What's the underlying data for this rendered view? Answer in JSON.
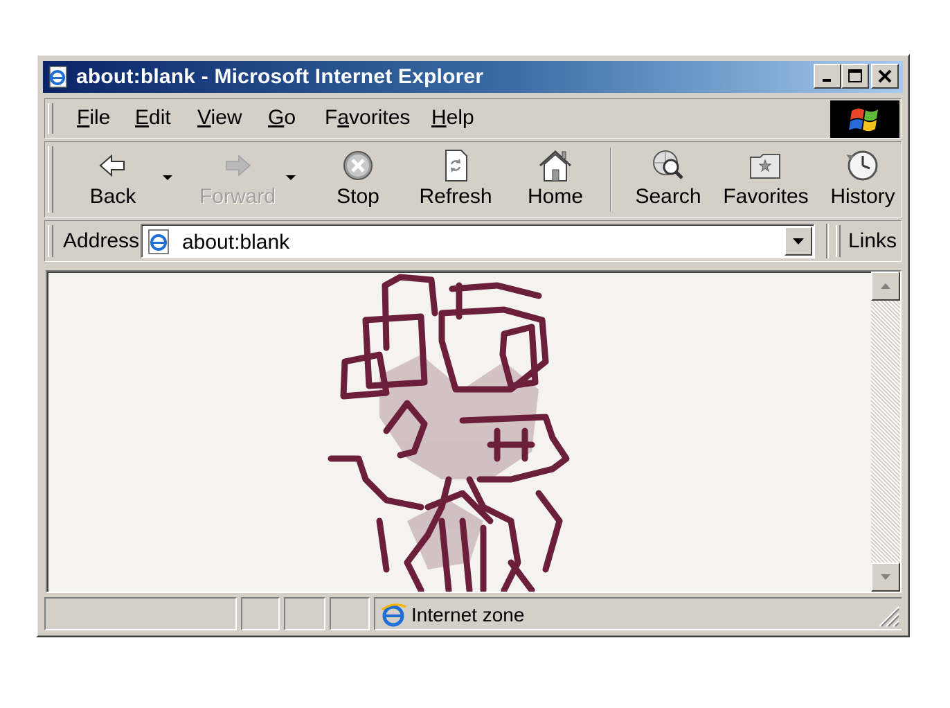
{
  "window": {
    "title": "about:blank - Microsoft Internet Explorer",
    "caption_buttons": [
      "minimize-icon",
      "maximize-icon",
      "close-icon"
    ]
  },
  "menubar": {
    "items": [
      {
        "label": "File",
        "accel": "F"
      },
      {
        "label": "Edit",
        "accel": "E"
      },
      {
        "label": "View",
        "accel": "V"
      },
      {
        "label": "Go",
        "accel": "G"
      },
      {
        "label": "Favorites",
        "accel": "a"
      },
      {
        "label": "Help",
        "accel": "H"
      }
    ]
  },
  "toolbar": {
    "back": "Back",
    "forward": "Forward",
    "stop": "Stop",
    "refresh": "Refresh",
    "home": "Home",
    "search": "Search",
    "favorites": "Favorites",
    "history": "History"
  },
  "address": {
    "label": "Address",
    "value": "about:blank",
    "links": "Links"
  },
  "status": {
    "zone": "Internet zone"
  },
  "colors": {
    "title_start": "#0a246a",
    "title_end": "#a6caf0",
    "chrome": "#d4d0c8",
    "ink": "#6b1f3a",
    "page_bg": "#f4f3ef"
  }
}
